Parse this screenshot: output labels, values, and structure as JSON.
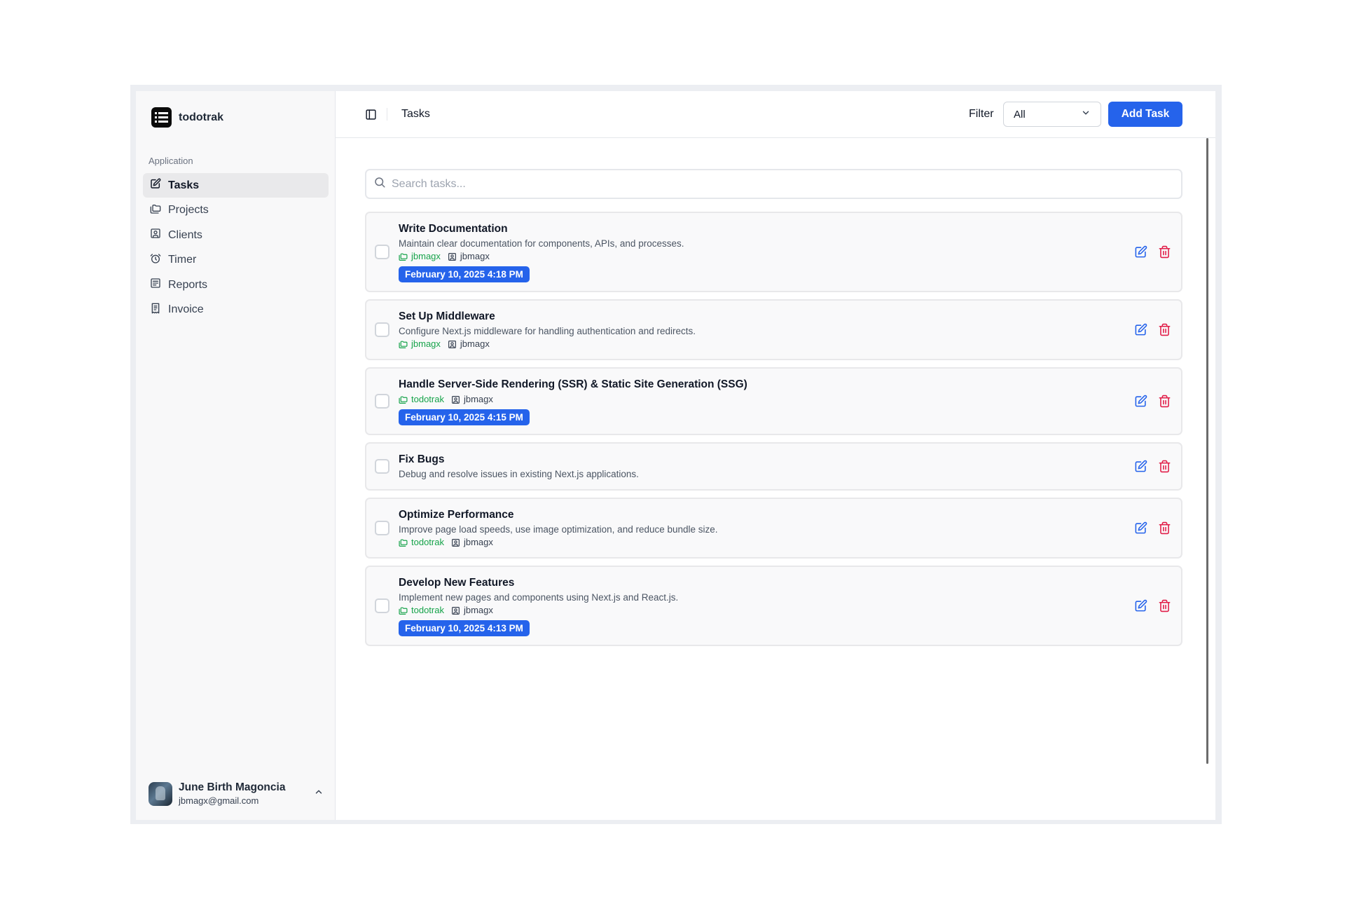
{
  "brand": {
    "name": "todotrak"
  },
  "sidebar": {
    "section_label": "Application",
    "items": [
      {
        "label": "Tasks",
        "icon": "edit-icon"
      },
      {
        "label": "Projects",
        "icon": "folders-icon"
      },
      {
        "label": "Clients",
        "icon": "contact-icon"
      },
      {
        "label": "Timer",
        "icon": "alarm-clock-icon"
      },
      {
        "label": "Reports",
        "icon": "report-icon"
      },
      {
        "label": "Invoice",
        "icon": "invoice-icon"
      }
    ]
  },
  "user": {
    "name": "June Birth Magoncia",
    "email": "jbmagx@gmail.com"
  },
  "header": {
    "title": "Tasks",
    "filter_label": "Filter",
    "filter_value": "All",
    "add_label": "Add Task"
  },
  "search": {
    "placeholder": "Search tasks..."
  },
  "tasks": [
    {
      "title": "Write Documentation",
      "description": "Maintain clear documentation for components, APIs, and processes.",
      "project": "jbmagx",
      "client": "jbmagx",
      "date": "February 10, 2025 4:18 PM"
    },
    {
      "title": "Set Up Middleware",
      "description": "Configure Next.js middleware for handling authentication and redirects.",
      "project": "jbmagx",
      "client": "jbmagx",
      "date": ""
    },
    {
      "title": "Handle Server-Side Rendering (SSR) & Static Site Generation (SSG)",
      "description": "",
      "project": "todotrak",
      "client": "jbmagx",
      "date": "February 10, 2025 4:15 PM"
    },
    {
      "title": "Fix Bugs",
      "description": "Debug and resolve issues in existing Next.js applications.",
      "project": "",
      "client": "",
      "date": ""
    },
    {
      "title": "Optimize Performance",
      "description": "Improve page load speeds, use image optimization, and reduce bundle size.",
      "project": "todotrak",
      "client": "jbmagx",
      "date": ""
    },
    {
      "title": "Develop New Features",
      "description": "Implement new pages and components using Next.js and React.js.",
      "project": "todotrak",
      "client": "jbmagx",
      "date": "February 10, 2025 4:13 PM"
    }
  ],
  "colors": {
    "accent": "#2563eb",
    "project": "#16a34a",
    "delete": "#e11d48"
  }
}
